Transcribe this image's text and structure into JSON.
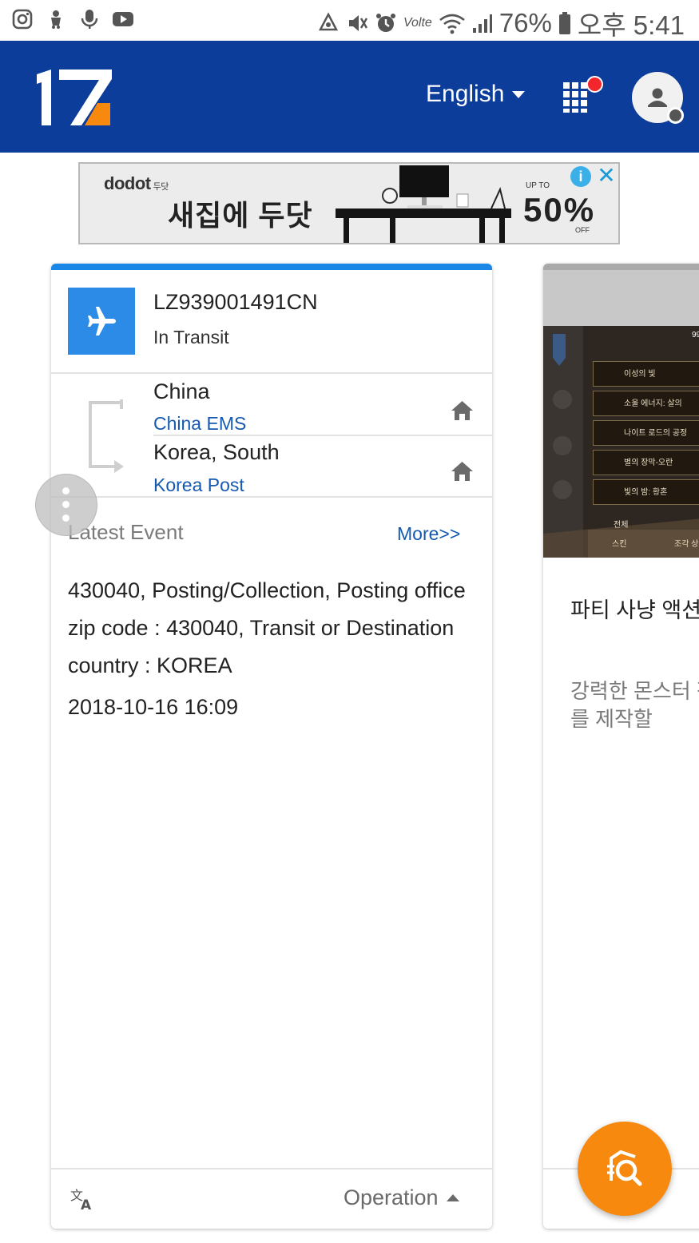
{
  "status_bar": {
    "battery_percent": "76%",
    "time": "오후 5:41",
    "network_label": "Volte",
    "icons": [
      "instagram-icon",
      "app-icon",
      "mic-icon",
      "youtube-icon",
      "recycle-icon",
      "mute-icon",
      "alarm-icon",
      "wifi-icon",
      "signal-icon",
      "battery-icon"
    ]
  },
  "header": {
    "logo_text": "17",
    "language_label": "English",
    "accent_color": "#0c3d9b",
    "logo_accent_color": "#f7890e"
  },
  "ad": {
    "brand": "dodot",
    "brand_korean": "두닷",
    "headline": "새집에 두닷",
    "upto": "UP TO",
    "discount": "50%",
    "off": "OFF",
    "info_icon": "info-icon",
    "close_icon": "close-icon"
  },
  "tracking": {
    "number": "LZ939001491CN",
    "status": "In Transit",
    "origin": {
      "country": "China",
      "carrier": "China EMS"
    },
    "destination": {
      "country": "Korea, South",
      "carrier": "Korea Post"
    },
    "latest_label": "Latest Event",
    "more_label": "More>>",
    "event_text": "430040, Posting/Collection, Posting office zip code : 430040, Transit or Destination country : KOREA",
    "event_time": "2018-10-16 16:09",
    "operation_label": "Operation"
  },
  "promo_card": {
    "title": "파티 사냥 액션중",
    "description": "강력한 몬스터 장비를 제작할",
    "game_rows": [
      "이성의 빛",
      "소울 에너지: 살의",
      "나이트 로드의 공정",
      "별의 장막-오란",
      "빛의 밤: 황혼"
    ],
    "game_tabs": [
      "전체",
      "스킨",
      "조각 상"
    ],
    "gem_count": "99"
  }
}
